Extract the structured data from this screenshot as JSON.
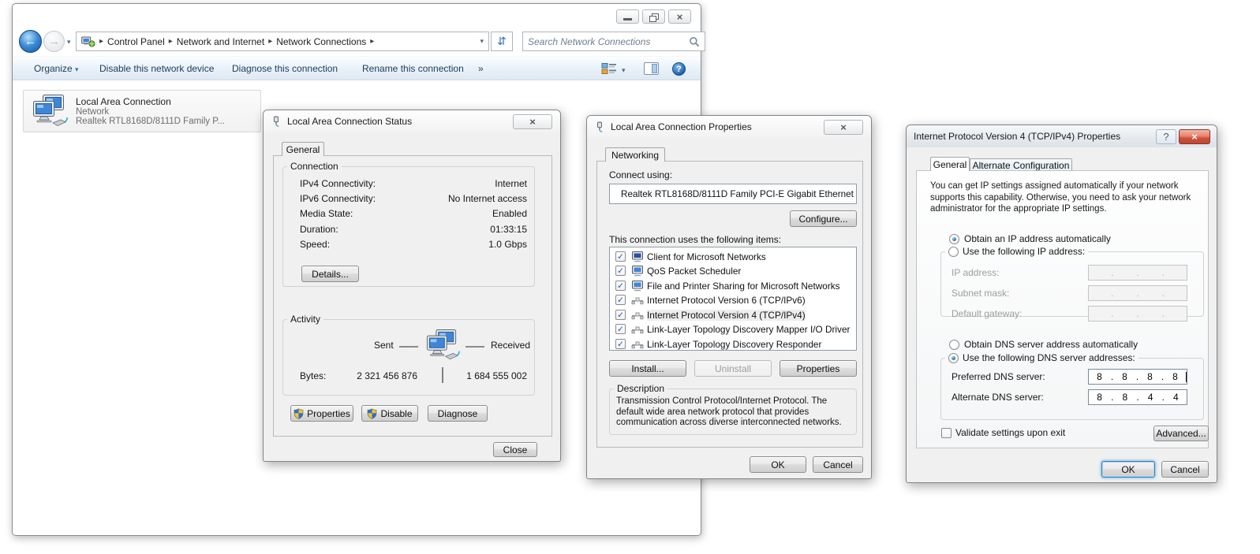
{
  "icons": {
    "breadcrumb_arrow": "▸",
    "dropdown_caret": "▾",
    "overflow_chevron": "»",
    "close_glyph": "×",
    "check_glyph": "✓",
    "refresh_glyph": "⇵",
    "help_glyph": "?",
    "back_glyph": "←",
    "forward_glyph": "→"
  },
  "colors": {
    "toolbar_text": "#1f3b57",
    "close_red": "#cf523c",
    "screen_blue": "#3e86d8"
  },
  "explorer": {
    "breadcrumb": [
      "Control Panel",
      "Network and Internet",
      "Network Connections"
    ],
    "search_placeholder": "Search Network Connections",
    "toolbar": {
      "organize": "Organize",
      "commands": [
        "Disable this network device",
        "Diagnose this connection",
        "Rename this connection"
      ]
    },
    "tile": {
      "title": "Local Area Connection",
      "status": "Network",
      "device": "Realtek RTL8168D/8111D Family P..."
    }
  },
  "status_dialog": {
    "title": "Local Area Connection Status",
    "tab": "General",
    "connection_group": "Connection",
    "activity_group": "Activity",
    "rows": [
      {
        "label": "IPv4 Connectivity:",
        "value": "Internet"
      },
      {
        "label": "IPv6 Connectivity:",
        "value": "No Internet access"
      },
      {
        "label": "Media State:",
        "value": "Enabled"
      },
      {
        "label": "Duration:",
        "value": "01:33:15"
      },
      {
        "label": "Speed:",
        "value": "1.0 Gbps"
      }
    ],
    "details_button": "Details...",
    "sent_label": "Sent",
    "received_label": "Received",
    "bytes_label": "Bytes:",
    "bytes_sent": "2 321 456 876",
    "bytes_received": "1 684 555 002",
    "properties_button": "Properties",
    "disable_button": "Disable",
    "diagnose_button": "Diagnose",
    "close_button": "Close"
  },
  "properties_dialog": {
    "title": "Local Area Connection Properties",
    "tab": "Networking",
    "connect_using_label": "Connect using:",
    "adapter": "Realtek RTL8168D/8111D Family PCI-E Gigabit Ethernet",
    "configure_button": "Configure...",
    "items_label": "This connection uses the following items:",
    "items": [
      {
        "label": "Client for Microsoft Networks",
        "checked": true
      },
      {
        "label": "QoS Packet Scheduler",
        "checked": true
      },
      {
        "label": "File and Printer Sharing for Microsoft Networks",
        "checked": true
      },
      {
        "label": "Internet Protocol Version 6 (TCP/IPv6)",
        "checked": true
      },
      {
        "label": "Internet Protocol Version 4 (TCP/IPv4)",
        "checked": true,
        "selected": true
      },
      {
        "label": "Link-Layer Topology Discovery Mapper I/O Driver",
        "checked": true
      },
      {
        "label": "Link-Layer Topology Discovery Responder",
        "checked": true
      }
    ],
    "install_button": "Install...",
    "uninstall_button": "Uninstall",
    "item_properties_button": "Properties",
    "description_label": "Description",
    "description": "Transmission Control Protocol/Internet Protocol. The default wide area network protocol that provides communication across diverse interconnected networks.",
    "ok_button": "OK",
    "cancel_button": "Cancel"
  },
  "ipv4_dialog": {
    "title": "Internet Protocol Version 4 (TCP/IPv4) Properties",
    "tabs": [
      "General",
      "Alternate Configuration"
    ],
    "intro": "You can get IP settings assigned automatically if your network supports this capability. Otherwise, you need to ask your network administrator for the appropriate IP settings.",
    "obtain_ip_radio": "Obtain an IP address automatically",
    "use_ip_radio": "Use the following IP address:",
    "ip_address_label": "IP address:",
    "subnet_mask_label": "Subnet mask:",
    "default_gateway_label": "Default gateway:",
    "obtain_dns_radio": "Obtain DNS server address automatically",
    "use_dns_radio": "Use the following DNS server addresses:",
    "preferred_dns_label": "Preferred DNS server:",
    "preferred_dns": [
      "8",
      "8",
      "8",
      "8"
    ],
    "alternate_dns_label": "Alternate DNS server:",
    "alternate_dns": [
      "8",
      "8",
      "4",
      "4"
    ],
    "octet_separator": ".",
    "validate_label": "Validate settings upon exit",
    "advanced_button": "Advanced...",
    "ok_button": "OK",
    "cancel_button": "Cancel"
  }
}
